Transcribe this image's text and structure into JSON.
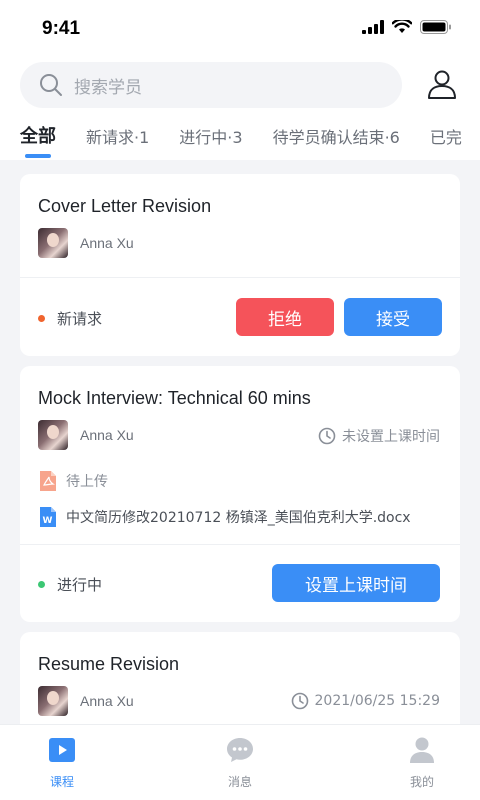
{
  "status_bar": {
    "time": "9:41"
  },
  "search": {
    "placeholder": "搜索学员"
  },
  "tabs": [
    {
      "label": "全部",
      "active": true
    },
    {
      "label": "新请求·1"
    },
    {
      "label": "进行中·3"
    },
    {
      "label": "待学员确认结束·6"
    },
    {
      "label": "已完"
    }
  ],
  "cards": [
    {
      "title": "Cover Letter Revision",
      "user": "Anna Xu",
      "status": "新请求",
      "status_color": "#f0642e",
      "reject_label": "拒绝",
      "accept_label": "接受"
    },
    {
      "title": "Mock Interview: Technical 60 mins",
      "user": "Anna Xu",
      "time": "未设置上课时间",
      "pending_upload": "待上传",
      "file_name": "中文简历修改20210712 杨镇泽_美国伯克利大学.docx",
      "status": "进行中",
      "status_color": "#3cc774",
      "schedule_label": "设置上课时间"
    },
    {
      "title": "Resume Revision",
      "user": "Anna Xu",
      "time": "2021/06/25 15:29"
    }
  ],
  "bottom_nav": [
    {
      "label": "课程",
      "icon": "course-icon",
      "active": true
    },
    {
      "label": "消息",
      "icon": "message-icon"
    },
    {
      "label": "我的",
      "icon": "profile-icon"
    }
  ],
  "colors": {
    "accent": "#3a8ef6",
    "danger": "#f5535a"
  }
}
